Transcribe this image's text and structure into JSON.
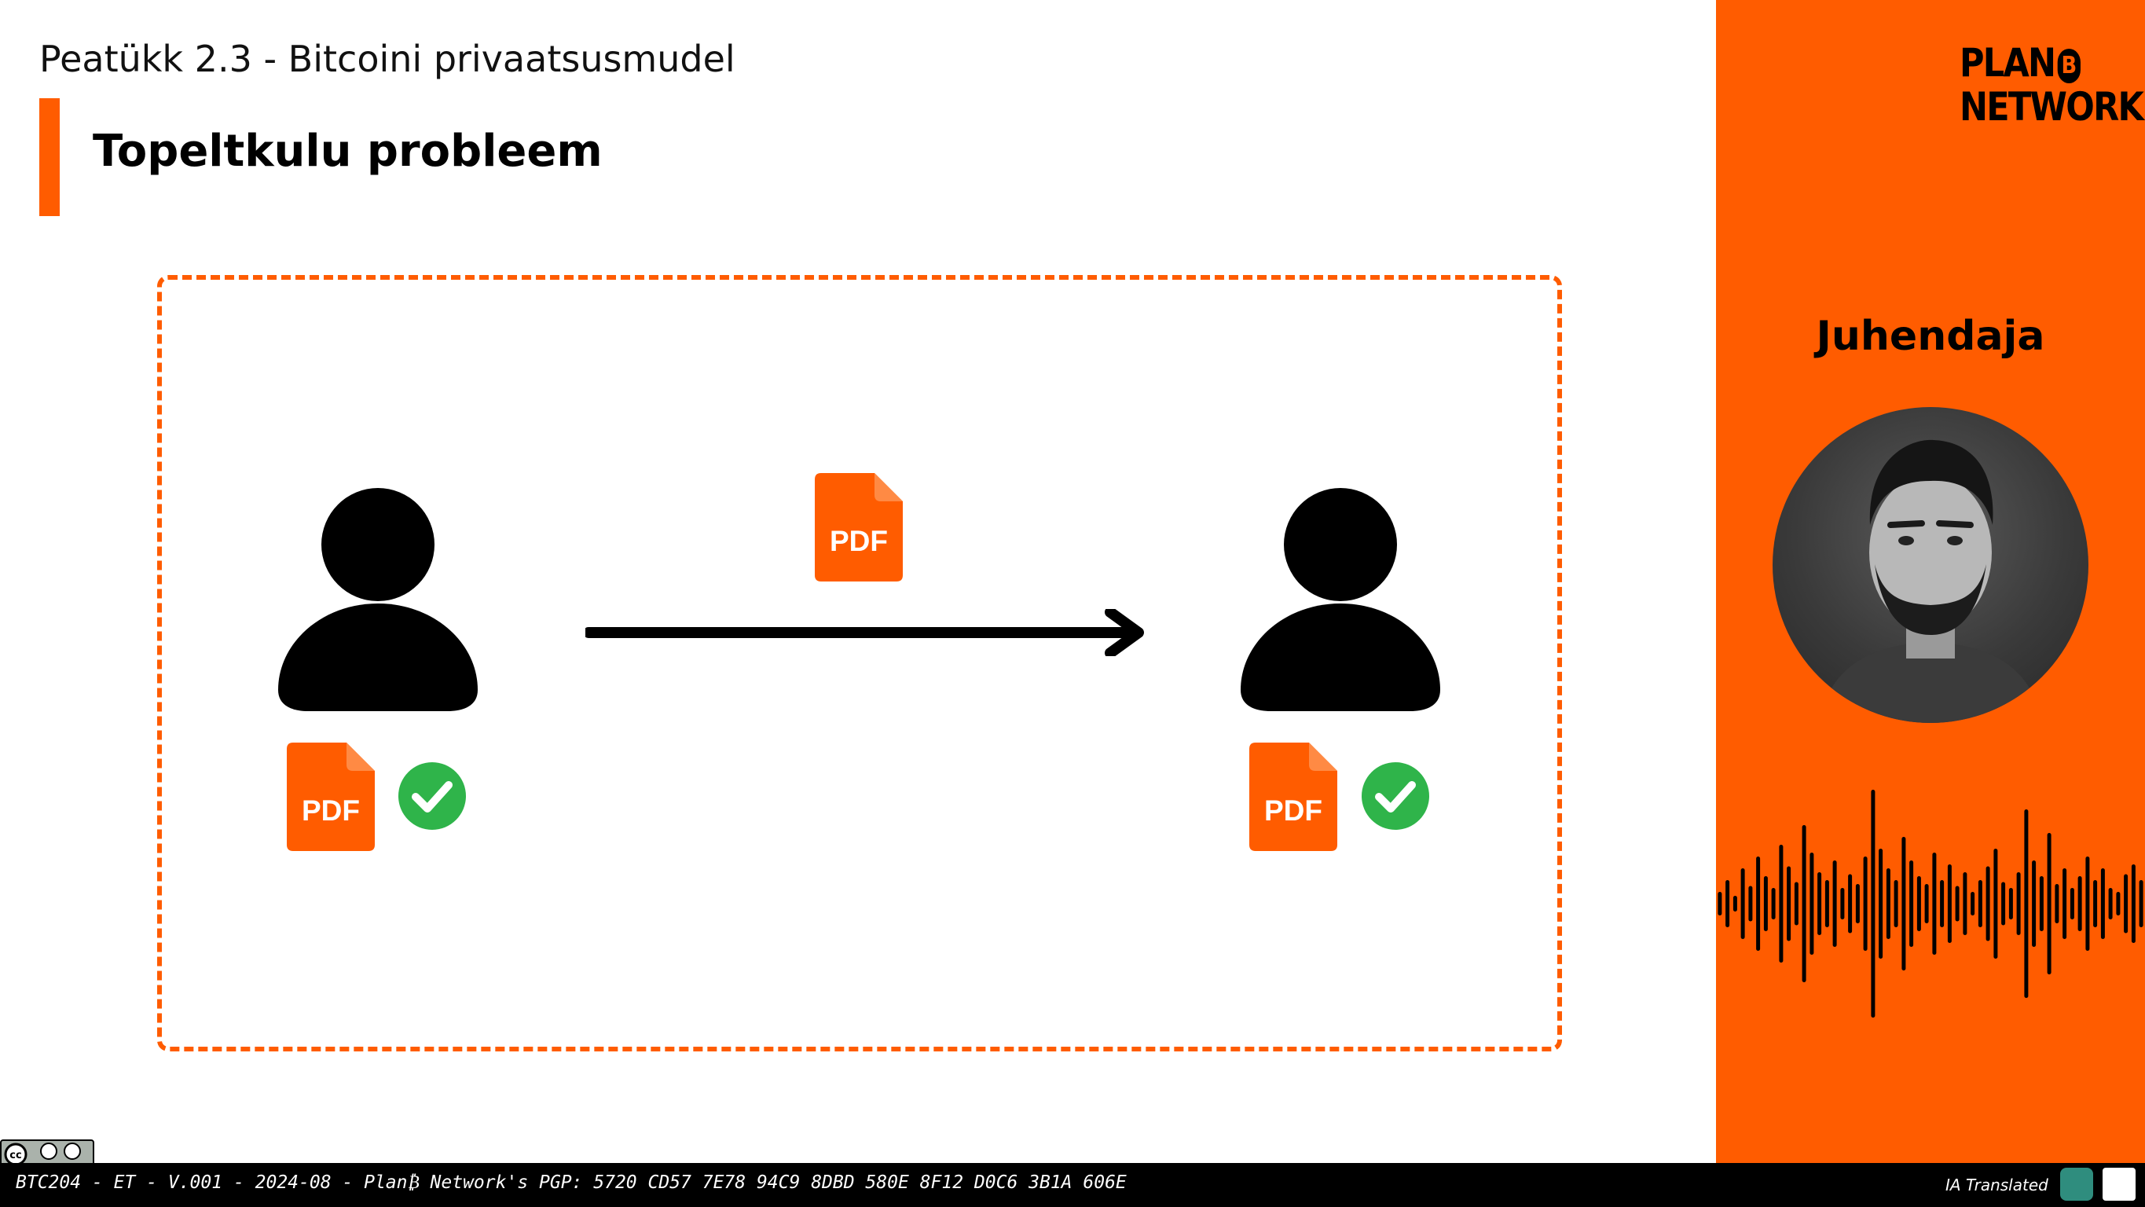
{
  "header": {
    "chapter": "Peatükk 2.3 - Bitcoini privaatsusmudel",
    "title": "Topeltkulu probleem"
  },
  "diagram": {
    "sender": {
      "file_label": "PDF",
      "file_icon": "pdf-file-icon",
      "status_icon": "checkmark-icon"
    },
    "transfer": {
      "file_label": "PDF",
      "arrow_icon": "right-arrow-icon"
    },
    "receiver": {
      "file_label": "PDF",
      "file_icon": "pdf-file-icon",
      "status_icon": "checkmark-icon"
    }
  },
  "sidebar": {
    "logo_line1": "PLAN",
    "logo_coin": "B",
    "logo_line2": "NETWORK",
    "instructor_label": "Juhendaja"
  },
  "footer": {
    "text": "BTC204 - ET - V.001 - 2024-08 - Plan₿ Network's PGP: 5720 CD57 7E78 94C9 8DBD 580E 8F12 D0C6 3B1A 606E",
    "ia_label": "IA Translated",
    "license_badge": "cc-by-sa-icon"
  },
  "colors": {
    "accent": "#ff5c00",
    "check_green": "#2fb44a",
    "text": "#000000",
    "background": "#ffffff"
  }
}
